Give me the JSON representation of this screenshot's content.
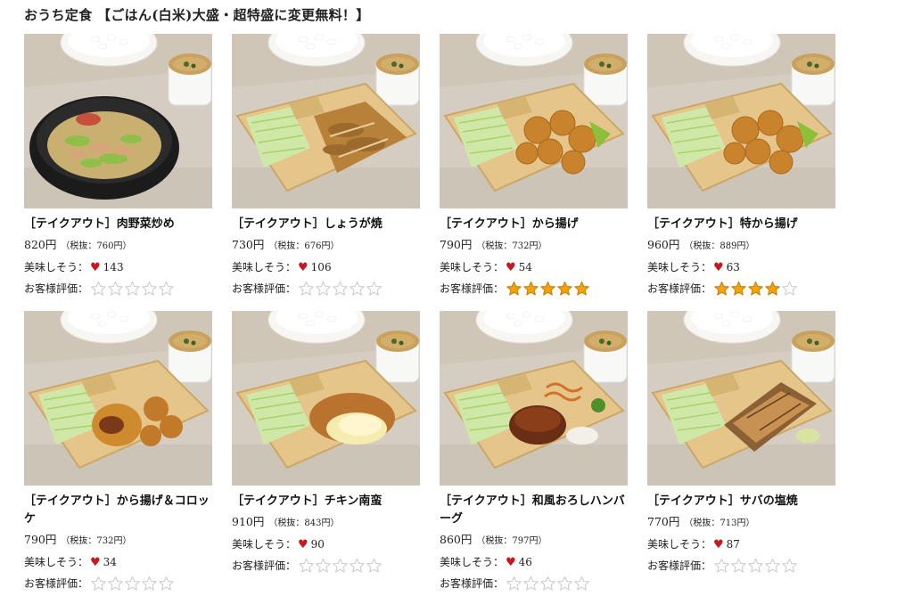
{
  "heading": "おうち定食 【ごはん(白米)大盛・超特盛に変更無料！】",
  "labels": {
    "likes": "美味しそう：",
    "rating": "お客様評価："
  },
  "colors": {
    "heart": "#c3191f",
    "star_filled": "#f2a20d",
    "star_empty": "#c9c9c9"
  },
  "products": [
    {
      "name": "［テイクアウト］肉野菜炒め",
      "name2": "",
      "price": "820円",
      "tax": "（税抜：760円）",
      "likes": "143",
      "stars": 0,
      "photo": "bowl"
    },
    {
      "name": "［テイクアウト］しょうが焼",
      "name2": "",
      "price": "730円",
      "tax": "（税抜：676円）",
      "likes": "106",
      "stars": 0,
      "photo": "ginger"
    },
    {
      "name": "［テイクアウト］から揚げ",
      "name2": "",
      "price": "790円",
      "tax": "（税抜：732円）",
      "likes": "54",
      "stars": 5,
      "photo": "karaage"
    },
    {
      "name": "［テイクアウト］特から揚げ",
      "name2": "",
      "price": "960円",
      "tax": "（税抜：889円）",
      "likes": "63",
      "stars": 4,
      "photo": "karaage"
    },
    {
      "name": "［テイクアウト］から揚げ＆コロッ",
      "name2": "ケ",
      "price": "790円",
      "tax": "（税抜：732円）",
      "likes": "34",
      "stars": 0,
      "photo": "croquette"
    },
    {
      "name": "［テイクアウト］チキン南蛮",
      "name2": "",
      "price": "910円",
      "tax": "（税抜：843円）",
      "likes": "90",
      "stars": 0,
      "photo": "nanban"
    },
    {
      "name": "［テイクアウト］和風おろしハンバ",
      "name2": "ーグ",
      "price": "860円",
      "tax": "（税抜：797円）",
      "likes": "46",
      "stars": 0,
      "photo": "hamburg"
    },
    {
      "name": "［テイクアウト］サバの塩焼",
      "name2": "",
      "price": "770円",
      "tax": "（税抜：713円）",
      "likes": "87",
      "stars": 0,
      "photo": "saba"
    }
  ]
}
